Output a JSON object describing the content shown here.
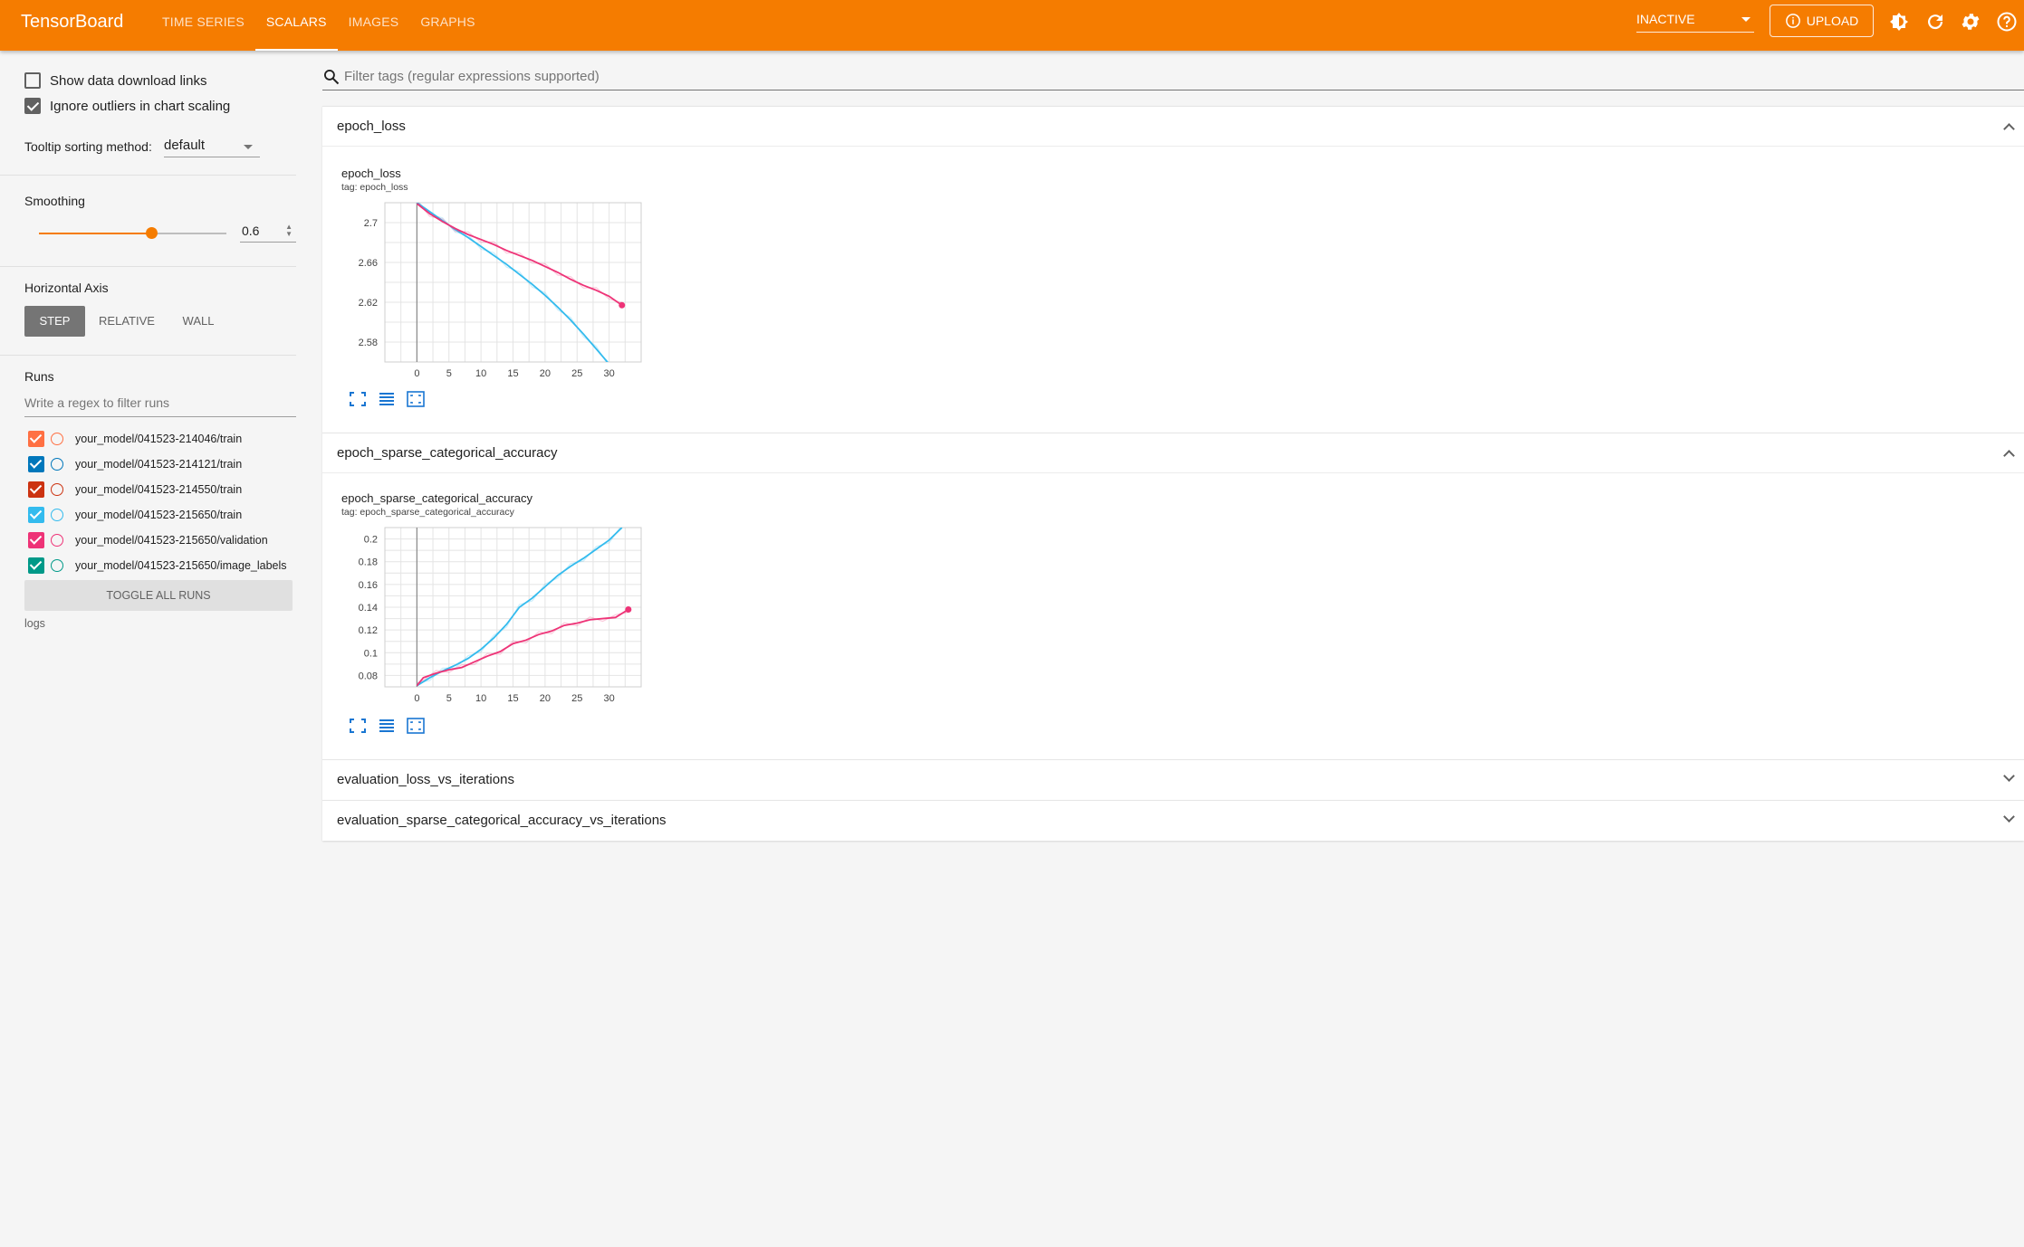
{
  "toolbar": {
    "brand": "TensorBoard",
    "tabs": [
      {
        "label": "TIME SERIES",
        "active": false
      },
      {
        "label": "SCALARS",
        "active": true
      },
      {
        "label": "IMAGES",
        "active": false
      },
      {
        "label": "GRAPHS",
        "active": false
      }
    ],
    "reload_select": "INACTIVE",
    "upload_label": "UPLOAD",
    "icons": [
      "info-icon",
      "theme-toggle-icon",
      "refresh-icon",
      "settings-icon",
      "help-icon"
    ],
    "accent": "#f57c00"
  },
  "sidebar": {
    "show_download_links": {
      "label": "Show data download links",
      "checked": false
    },
    "ignore_outliers": {
      "label": "Ignore outliers in chart scaling",
      "checked": true
    },
    "tooltip_label": "Tooltip sorting method:",
    "tooltip_value": "default",
    "smoothing_label": "Smoothing",
    "smoothing_value": "0.6",
    "smoothing_fraction": 0.6,
    "horizontal_axis_label": "Horizontal Axis",
    "axis_options": [
      {
        "label": "STEP",
        "active": true
      },
      {
        "label": "RELATIVE",
        "active": false
      },
      {
        "label": "WALL",
        "active": false
      }
    ],
    "runs_label": "Runs",
    "runs_filter_placeholder": "Write a regex to filter runs",
    "runs": [
      {
        "name": "your_model/041523-214046/train",
        "color": "#ff7043",
        "checked": true
      },
      {
        "name": "your_model/041523-214121/train",
        "color": "#0077bb",
        "checked": true
      },
      {
        "name": "your_model/041523-214550/train",
        "color": "#cc3311",
        "checked": true
      },
      {
        "name": "your_model/041523-215650/train",
        "color": "#33bbee",
        "checked": true
      },
      {
        "name": "your_model/041523-215650/validation",
        "color": "#ee3377",
        "checked": true
      },
      {
        "name": "your_model/041523-215650/image_labels",
        "color": "#009988",
        "checked": true
      }
    ],
    "toggle_all_label": "TOGGLE ALL RUNS",
    "logs_label": "logs"
  },
  "main": {
    "filter_placeholder": "Filter tags (regular expressions supported)",
    "sections": [
      {
        "title": "epoch_loss",
        "expanded": true
      },
      {
        "title": "epoch_sparse_categorical_accuracy",
        "expanded": true
      },
      {
        "title": "evaluation_loss_vs_iterations",
        "expanded": false
      },
      {
        "title": "evaluation_sparse_categorical_accuracy_vs_iterations",
        "expanded": false
      }
    ]
  },
  "chart_data": [
    {
      "type": "line",
      "title": "epoch_loss",
      "subtitle": "tag: epoch_loss",
      "xlim": [
        -5,
        35
      ],
      "ylim": [
        2.56,
        2.72
      ],
      "xticks": [
        0,
        5,
        10,
        15,
        20,
        25,
        30
      ],
      "yticks": [
        2.58,
        2.62,
        2.66,
        2.7
      ],
      "ytick_labels": [
        "2.58",
        "2.62",
        "2.66",
        "2.7"
      ],
      "grid": true,
      "series": [
        {
          "color": "#33bbee",
          "x": [
            0,
            2,
            4,
            6,
            8,
            10,
            12,
            14,
            16,
            18,
            20,
            22,
            24,
            26,
            28,
            30
          ],
          "y": [
            2.72,
            2.711,
            2.702,
            2.693,
            2.685,
            2.676,
            2.667,
            2.658,
            2.648,
            2.638,
            2.627,
            2.615,
            2.602,
            2.588,
            2.573,
            2.558
          ]
        },
        {
          "color": "#ee3377",
          "x": [
            0,
            2,
            4,
            6,
            8,
            10,
            12,
            14,
            16,
            18,
            20,
            22,
            24,
            26,
            28,
            30,
            32
          ],
          "y": [
            2.719,
            2.709,
            2.701,
            2.694,
            2.688,
            2.683,
            2.678,
            2.672,
            2.667,
            2.662,
            2.656,
            2.65,
            2.643,
            2.637,
            2.632,
            2.626,
            2.617
          ]
        }
      ]
    },
    {
      "type": "line",
      "title": "epoch_sparse_categorical_accuracy",
      "subtitle": "tag: epoch_sparse_categorical_accuracy",
      "xlim": [
        -5,
        35
      ],
      "ylim": [
        0.07,
        0.21
      ],
      "xticks": [
        0,
        5,
        10,
        15,
        20,
        25,
        30
      ],
      "yticks": [
        0.08,
        0.1,
        0.12,
        0.14,
        0.16,
        0.18,
        0.2
      ],
      "ytick_labels": [
        "0.08",
        "0.1",
        "0.12",
        "0.14",
        "0.16",
        "0.18",
        "0.2"
      ],
      "grid": true,
      "series": [
        {
          "color": "#33bbee",
          "x": [
            0,
            2,
            4,
            6,
            8,
            10,
            12,
            14,
            16,
            18,
            20,
            22,
            24,
            26,
            28,
            30,
            32
          ],
          "y": [
            0.071,
            0.078,
            0.084,
            0.089,
            0.095,
            0.103,
            0.113,
            0.125,
            0.14,
            0.148,
            0.158,
            0.168,
            0.176,
            0.183,
            0.191,
            0.199,
            0.21
          ]
        },
        {
          "color": "#ee3377",
          "x": [
            0,
            1,
            3,
            5,
            7,
            9,
            11,
            13,
            15,
            17,
            19,
            21,
            23,
            25,
            27,
            29,
            31,
            33
          ],
          "y": [
            0.071,
            0.078,
            0.082,
            0.085,
            0.087,
            0.092,
            0.097,
            0.101,
            0.108,
            0.111,
            0.116,
            0.119,
            0.124,
            0.126,
            0.129,
            0.13,
            0.131,
            0.138
          ]
        }
      ]
    }
  ]
}
